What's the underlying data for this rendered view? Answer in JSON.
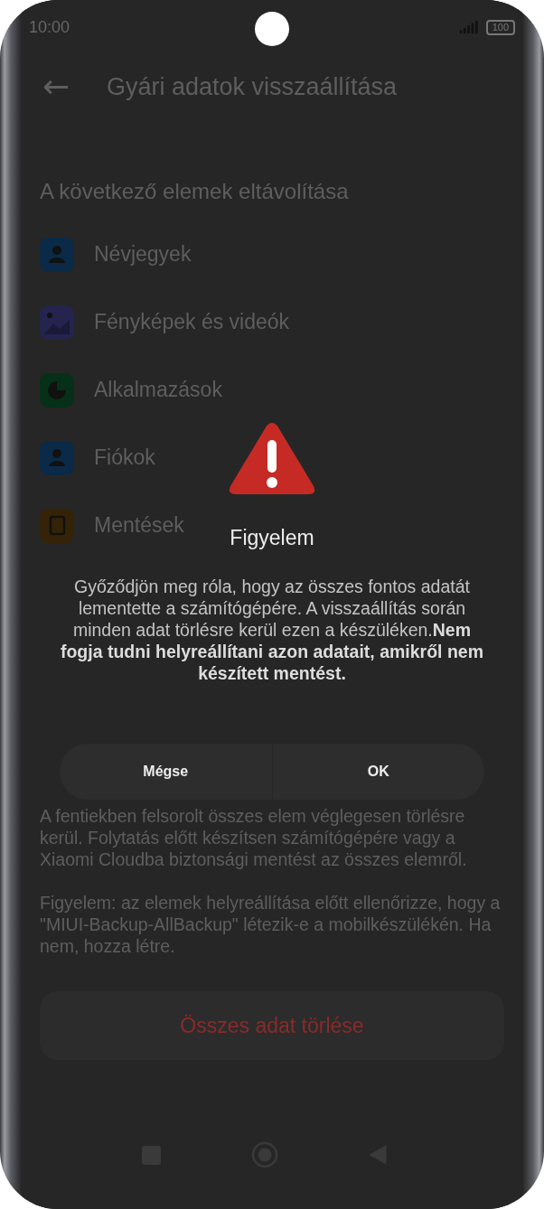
{
  "status_bar": {
    "time": "10:00",
    "battery": "100"
  },
  "header": {
    "back": "←",
    "title": "Gyári adatok visszaállítása"
  },
  "section_title": "A következő elemek eltávolítása",
  "items": [
    {
      "label": "Névjegyek"
    },
    {
      "label": "Fényképek és videók"
    },
    {
      "label": "Alkalmazások"
    },
    {
      "label": "Fiókok"
    },
    {
      "label": "Mentések"
    }
  ],
  "paragraphs": [
    "A fentiekben felsorolt összes elem véglegesen törlésre kerül. Folytatás előtt készítsen számítógépére vagy a Xiaomi Cloudba biztonsági mentést az összes elemről.",
    "Figyelem: az elemek helyreállítása előtt ellenőrizze, hogy a \"MIUI-Backup-AllBackup\" létezik-e a mobilkészülékén. Ha nem, hozza létre."
  ],
  "erase_button": "Összes adat törlése",
  "dialog": {
    "title": "Figyelem",
    "message": "Győződjön meg róla, hogy az összes fontos adatát lementette a számítógépére. A visszaállítás során minden adat törlésre kerül ezen a készüléken.**Nem fogja tudni helyreállítani azon adatait, amikről nem készített mentést.**",
    "buttons": [
      "Mégse",
      "OK"
    ]
  }
}
